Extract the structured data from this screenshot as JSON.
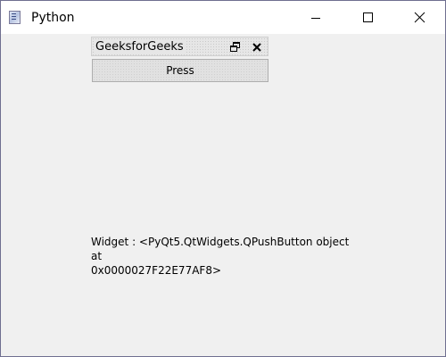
{
  "window": {
    "title": "Python",
    "icon": "python-app-icon",
    "controls": {
      "minimize_icon": "minimize-icon",
      "maximize_icon": "maximize-icon",
      "close_icon": "close-icon"
    }
  },
  "dock": {
    "title": "GeeksforGeeks",
    "float_icon": "float-icon",
    "close_icon": "close-icon"
  },
  "button": {
    "label": "Press"
  },
  "info": {
    "text": "Widget : <PyQt5.QtWidgets.QPushButton object at\n0x0000027F22E77AF8>"
  },
  "colors": {
    "window_bg": "#f0f0f0",
    "titlebar_bg": "#ffffff",
    "border": "#6f6f90"
  }
}
